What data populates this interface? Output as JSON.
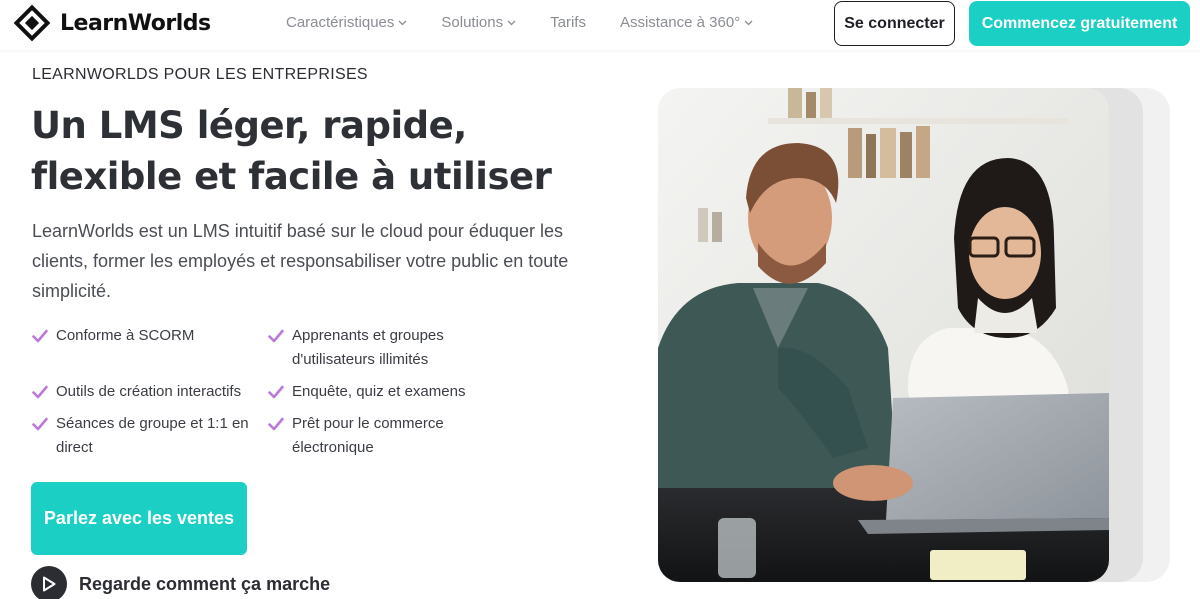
{
  "brand": {
    "name": "LearnWorlds",
    "accent_color": "#1ccfc4",
    "check_color": "#b97ad9"
  },
  "nav": {
    "items": [
      {
        "label": "Caractéristiques",
        "has_dropdown": true
      },
      {
        "label": "Solutions",
        "has_dropdown": true
      },
      {
        "label": "Tarifs",
        "has_dropdown": false
      },
      {
        "label": "Assistance à 360°",
        "has_dropdown": true
      }
    ],
    "login_label": "Se connecter",
    "start_label": "Commencez gratuitement"
  },
  "hero": {
    "eyebrow": "LEARNWORLDS POUR LES ENTREPRISES",
    "headline_line1": "Un LMS léger, rapide,",
    "headline_line2": "flexible et facile à utiliser",
    "description": "LearnWorlds est un LMS intuitif basé sur le cloud pour éduquer les clients, former les employés et responsabiliser votre public en toute simplicité.",
    "features": [
      "Conforme à SCORM",
      "Apprenants et groupes d'utilisateurs illimités",
      "Outils de création interactifs",
      "Enquête, quiz et examens",
      "Séances de groupe et 1:1 en direct",
      "Prêt pour le commerce électronique"
    ],
    "sales_button": "Parlez avec les ventes",
    "video_link": "Regarde comment ça marche",
    "photo_icon": "office-people-laptop-image"
  }
}
